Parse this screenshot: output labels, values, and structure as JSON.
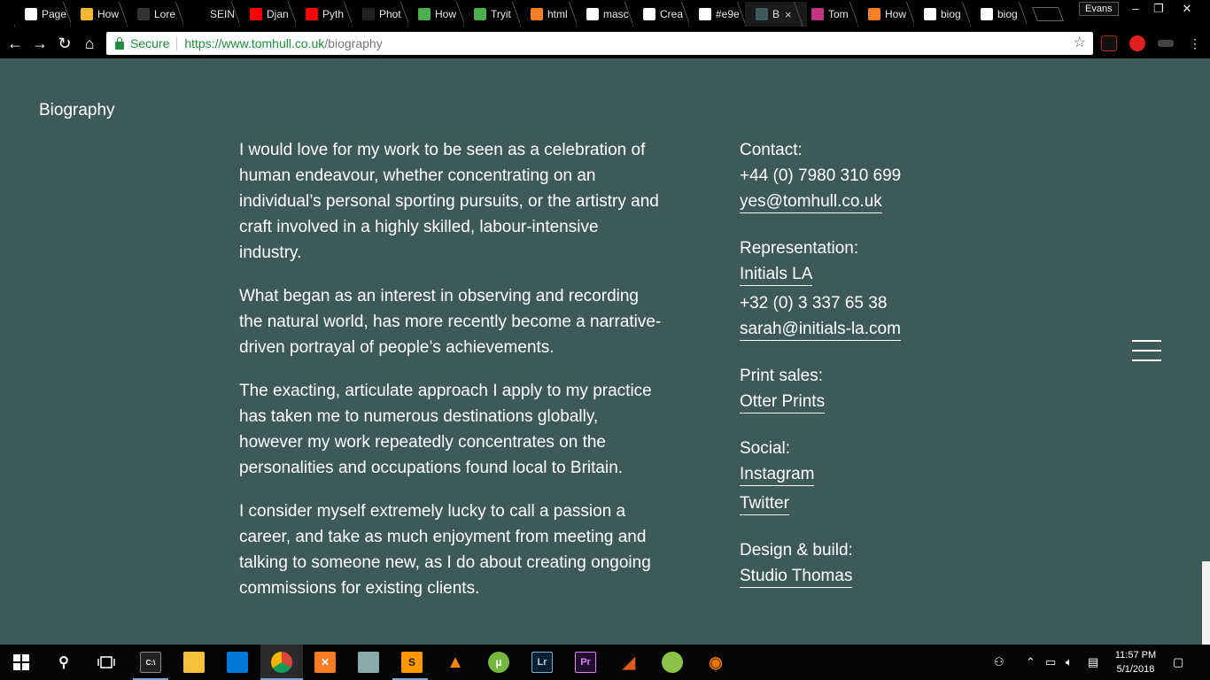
{
  "browser": {
    "tabs": [
      {
        "title": "Page",
        "icon": "page-icon",
        "color": "#ffffff"
      },
      {
        "title": "How",
        "icon": "h-icon",
        "color": "#f2b632"
      },
      {
        "title": "Lore",
        "icon": "lorem-icon",
        "color": "#333333"
      },
      {
        "title": "SEIN",
        "icon": "s-icon",
        "color": "#000000"
      },
      {
        "title": "Djan",
        "icon": "youtube-icon",
        "color": "#ff0000"
      },
      {
        "title": "Pyth",
        "icon": "youtube-icon",
        "color": "#ff0000"
      },
      {
        "title": "Phot",
        "icon": "github-icon",
        "color": "#222222"
      },
      {
        "title": "How",
        "icon": "w3-icon",
        "color": "#4caf50"
      },
      {
        "title": "Tryit",
        "icon": "w3-icon",
        "color": "#4caf50"
      },
      {
        "title": "html",
        "icon": "stackoverflow-icon",
        "color": "#f48024"
      },
      {
        "title": "masc",
        "icon": "google-icon",
        "color": "#ffffff"
      },
      {
        "title": "Crea",
        "icon": "page-icon",
        "color": "#ffffff"
      },
      {
        "title": "#e9e",
        "icon": "google-icon",
        "color": "#ffffff"
      },
      {
        "title": "B",
        "icon": "tomhull-icon",
        "color": "#3d5a58",
        "close": "×"
      },
      {
        "title": "Tom",
        "icon": "instagram-icon",
        "color": "#c13584"
      },
      {
        "title": "How",
        "icon": "asterisk-icon",
        "color": "#f58025"
      },
      {
        "title": "biog",
        "icon": "google-icon",
        "color": "#ffffff"
      },
      {
        "title": "biog",
        "icon": "page-icon",
        "color": "#ffffff"
      }
    ],
    "profile": "Evans",
    "window": {
      "minimize": "–",
      "restore": "❐",
      "close": "✕"
    },
    "address": {
      "secure_label": "Secure",
      "url_host": "https://www.tomhull.co.uk",
      "url_path": "/biography"
    }
  },
  "page": {
    "title": "Biography",
    "paragraphs": [
      "I would love for my work to be seen as a celebration of human endeavour, whether concentrating on an individual’s personal sporting pursuits, or the artistry and craft involved in a highly skilled, labour-intensive industry.",
      "What began as an interest in observing and recording the natural world, has more recently become a narrative-driven portrayal of people’s achievements.",
      "The exacting, articulate approach I apply to my practice has taken me to numerous destinations globally, however my work repeatedly concentrates on the personalities and occupations found local to Britain.",
      "I consider myself extremely lucky to call a passion a career, and take as much enjoyment from meeting and talking to someone new, as I do about creating ongoing commissions for existing clients."
    ],
    "contact": {
      "label": "Contact:",
      "phone": "+44 (0) 7980 310 699",
      "email": "yes@tomhull.co.uk"
    },
    "representation": {
      "label": "Representation:",
      "agency": "Initials LA",
      "phone": "+32 (0) 3 337 65 38",
      "email": "sarah@initials-la.com"
    },
    "print_sales": {
      "label": "Print sales:",
      "link": "Otter Prints"
    },
    "social": {
      "label": "Social:",
      "instagram": "Instagram",
      "twitter": "Twitter"
    },
    "design": {
      "label": "Design & build:",
      "link": "Studio Thomas"
    }
  },
  "taskbar": {
    "time": "11:57 PM",
    "date": "5/1/2018"
  },
  "colors": {
    "page_bg": "#3d5a58",
    "text": "#ffffff"
  }
}
